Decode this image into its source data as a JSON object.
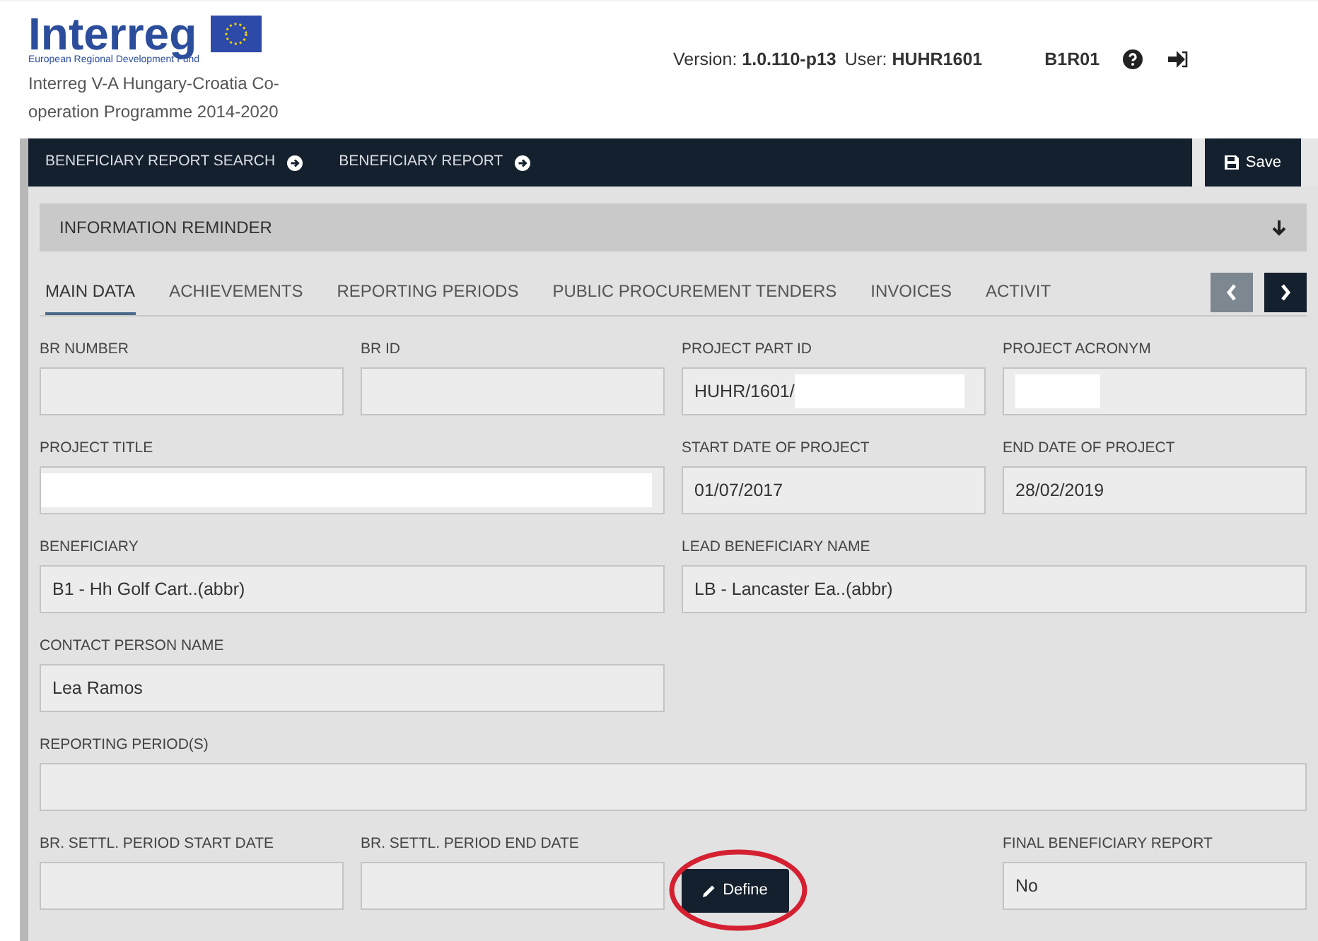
{
  "header": {
    "logo": "Interreg",
    "logo_subtitle": "European Regional Development Fund",
    "programme": "Interreg V-A Hungary-Croatia Co-operation Programme 2014-2020",
    "version_label": "Version:",
    "version": "1.0.110-p13",
    "user_label": "User:",
    "user": "HUHR1601",
    "role": "B1R01"
  },
  "nav": {
    "items": [
      {
        "label": "BENEFICIARY REPORT SEARCH"
      },
      {
        "label": "BENEFICIARY REPORT"
      }
    ],
    "save": "Save"
  },
  "reminder": {
    "title": "INFORMATION REMINDER",
    "expanded": false
  },
  "tabs": [
    {
      "label": "MAIN DATA",
      "selected": true
    },
    {
      "label": "ACHIEVEMENTS",
      "selected": false
    },
    {
      "label": "REPORTING PERIODS",
      "selected": false
    },
    {
      "label": "PUBLIC PROCUREMENT TENDERS",
      "selected": false
    },
    {
      "label": "INVOICES",
      "selected": false
    },
    {
      "label": "ACTIVIT",
      "selected": false
    }
  ],
  "tab_scroll": [
    {
      "disabled": true
    },
    {
      "disabled": false
    }
  ],
  "fields": [
    {
      "kind": "field",
      "label": "BR NUMBER"
    },
    {
      "kind": "field",
      "label": "BR ID"
    },
    {
      "kind": "field",
      "label": "PROJECT PART ID",
      "value": "HUHR/1601/",
      "redacted": true
    },
    {
      "kind": "field",
      "label": "PROJECT ACRONYM",
      "redacted": true
    },
    {
      "kind": "wide",
      "label": "PROJECT TITLE",
      "redacted": true
    },
    {
      "kind": "field",
      "label": "START DATE OF PROJECT",
      "value": "01/07/2017"
    },
    {
      "kind": "field",
      "label": "END DATE OF PROJECT",
      "value": "28/02/2019"
    },
    {
      "kind": "wide",
      "label": "BENEFICIARY",
      "value": "B1 - Hh Golf Cart..(abbr)"
    },
    {
      "kind": "wide",
      "label": "LEAD BENEFICIARY NAME",
      "value": "LB - Lancaster Ea..(abbr)"
    },
    {
      "kind": "wide",
      "label": "CONTACT PERSON NAME",
      "value": "Lea Ramos"
    },
    {
      "kind": "gap"
    },
    {
      "kind": "full",
      "label": "REPORTING PERIOD(S)"
    },
    {
      "kind": "field",
      "label": "BR. SETTL. PERIOD START DATE"
    },
    {
      "kind": "field",
      "label": "BR. SETTL. PERIOD END DATE"
    },
    {
      "kind": "button",
      "label": "Define",
      "circled": true
    },
    {
      "kind": "field",
      "label": "FINAL BENEFICIARY REPORT",
      "value": "No"
    }
  ]
}
